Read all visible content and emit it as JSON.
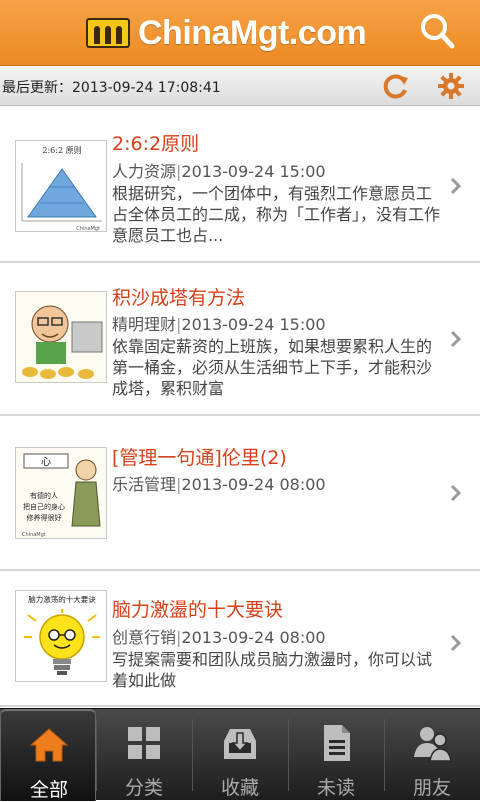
{
  "header": {
    "logo_text": "ChinaMgt.com",
    "logo_text_color": "#ffffff",
    "bar_color": "#ec8a22"
  },
  "status": {
    "last_update_label": "最后更新：2013-09-24 17:08:41"
  },
  "articles": [
    {
      "title": "2:6:2原则",
      "category": "人力资源",
      "time": "2013-09-24 15:00",
      "summary": "根据研究，一个团体中，有强烈工作意愿员工占全体员工的二成，称为「工作者」，没有工作意愿员工也占...",
      "thumb_caption": "2:6:2 原则",
      "thumb_logo": "ChinaMgt"
    },
    {
      "title": "积沙成塔有方法",
      "category": "精明理财",
      "time": "2013-09-24 15:00",
      "summary": "依靠固定薪资的上班族，如果想要累积人生的第一桶金，必须从生活细节上下手，才能积沙成塔，累积财富"
    },
    {
      "title": "[管理一句通]伦里(2)",
      "category": "乐活管理",
      "time": "2013-09-24 08:00",
      "summary": "",
      "thumb_char": "心",
      "thumb_line1": "有德的人",
      "thumb_line2": "把自己的身心",
      "thumb_line3": "修养得很好",
      "thumb_logo": "ChinaMgt"
    },
    {
      "title": "脑力激盪的十大要诀",
      "category": "创意行销",
      "time": "2013-09-24 08:00",
      "summary": "写提案需要和团队成员脑力激盪时，你可以试着如此做",
      "thumb_caption": "脑力激荡的十大要诀"
    }
  ],
  "tabs": [
    {
      "label": "全部",
      "icon": "home-icon",
      "active": true
    },
    {
      "label": "分类",
      "icon": "grid-icon",
      "active": false
    },
    {
      "label": "收藏",
      "icon": "inbox-icon",
      "active": false
    },
    {
      "label": "未读",
      "icon": "document-icon",
      "active": false
    },
    {
      "label": "朋友",
      "icon": "people-icon",
      "active": false
    }
  ],
  "colors": {
    "title_red": "#d8401a",
    "accent_orange": "#ec8a22"
  }
}
